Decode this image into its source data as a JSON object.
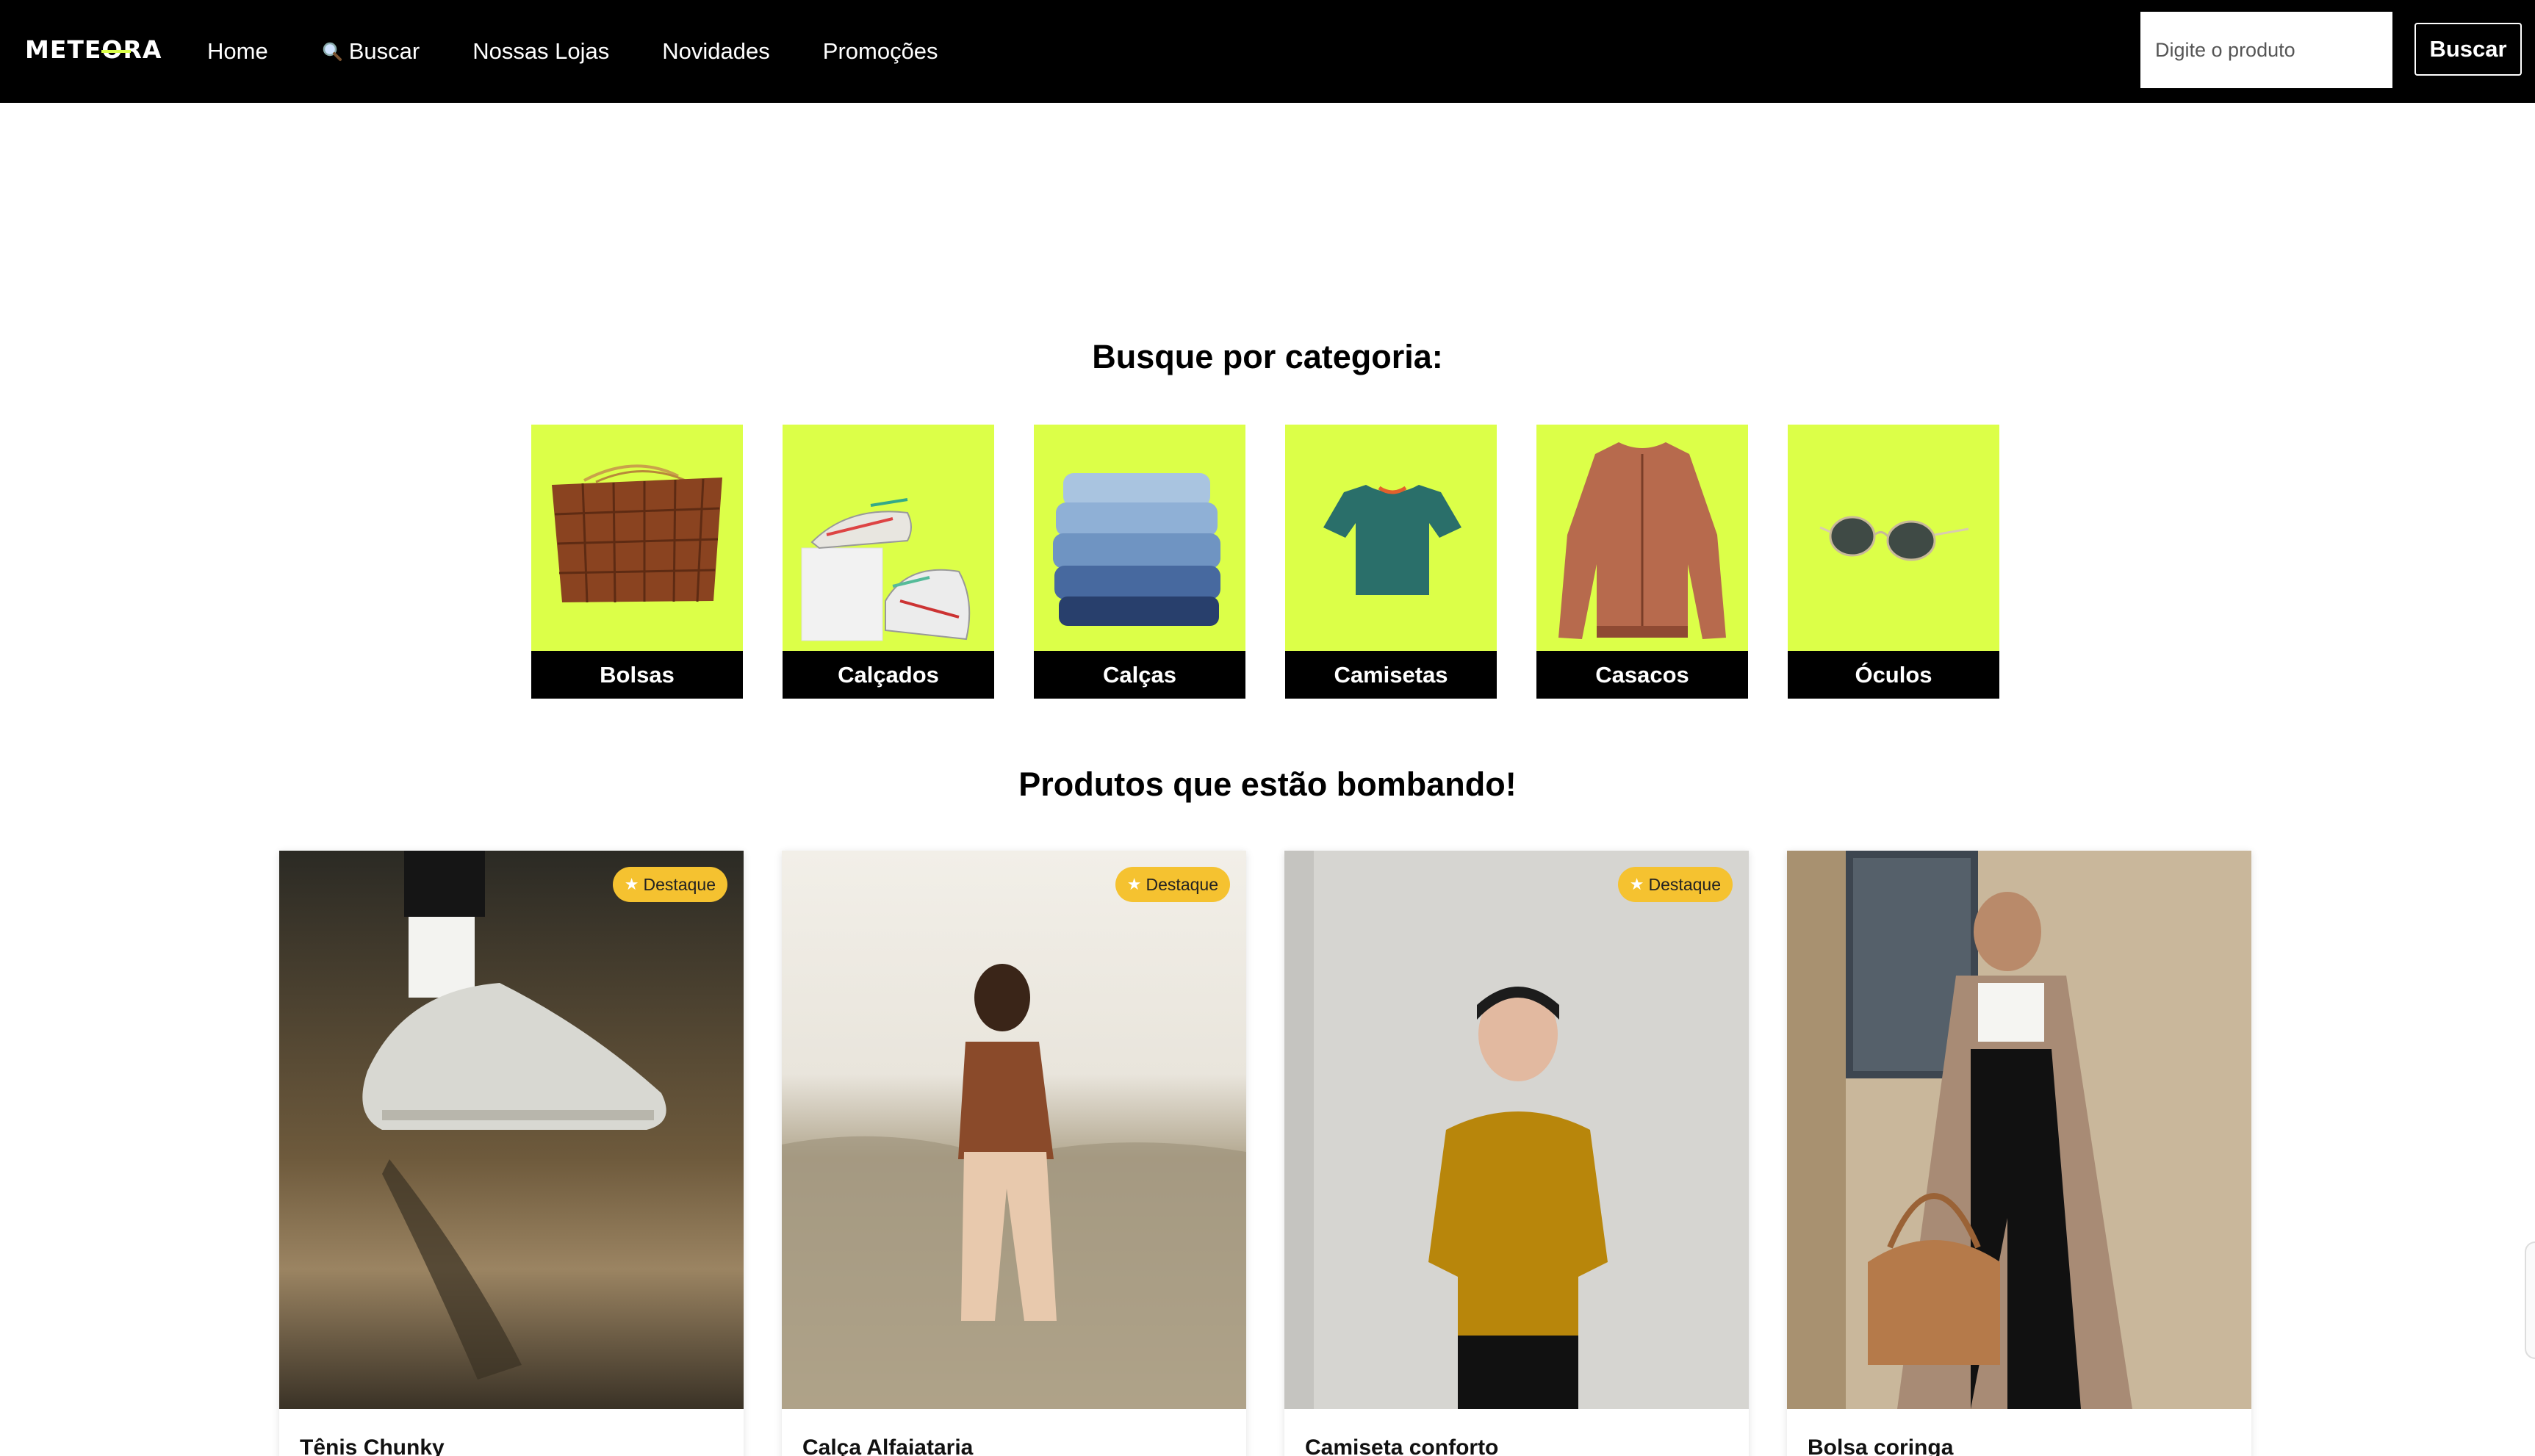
{
  "navbar": {
    "logo_text": "METEORA",
    "links": [
      {
        "label": "Home",
        "icon": ""
      },
      {
        "label": "Buscar",
        "icon": "search-icon"
      },
      {
        "label": "Nossas Lojas",
        "icon": ""
      },
      {
        "label": "Novidades",
        "icon": ""
      },
      {
        "label": "Promoções",
        "icon": ""
      }
    ],
    "search_placeholder": "Digite o produto",
    "search_button": "Buscar"
  },
  "categories": {
    "title": "Busque por categoria:",
    "items": [
      {
        "label": "Bolsas",
        "icon": "handbag-image"
      },
      {
        "label": "Calçados",
        "icon": "sneakers-image"
      },
      {
        "label": "Calças",
        "icon": "jeans-stack-image"
      },
      {
        "label": "Camisetas",
        "icon": "tshirt-image"
      },
      {
        "label": "Casacos",
        "icon": "jacket-image"
      },
      {
        "label": "Óculos",
        "icon": "sunglasses-image"
      }
    ]
  },
  "products": {
    "title": "Produtos que estão bombando!",
    "items": [
      {
        "name": "Tênis Chunky",
        "badge": "Destaque",
        "featured": true
      },
      {
        "name": "Calça Alfaiataria",
        "badge": "Destaque",
        "featured": true
      },
      {
        "name": "Camiseta conforto",
        "badge": "Destaque",
        "featured": true
      },
      {
        "name": "Bolsa coringa",
        "badge": "",
        "featured": false
      }
    ]
  },
  "colors": {
    "navbar_bg": "#000000",
    "accent_lime": "#dcff48",
    "badge_yellow": "#f5c230"
  }
}
